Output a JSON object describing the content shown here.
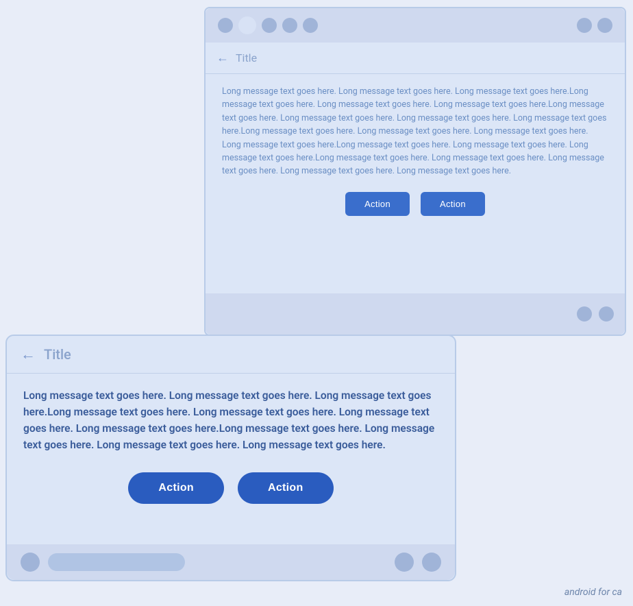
{
  "top_frame": {
    "status_dots": [
      "dot1",
      "dot2",
      "dot3",
      "dot4",
      "dot5"
    ],
    "status_right_dots": [
      "dot-r1",
      "dot-r2"
    ],
    "nav": {
      "back_label": "←",
      "title": "Title"
    },
    "message": "Long message text goes here. Long message text goes here. Long message text goes here.Long message text goes here. Long message text goes here. Long message text goes here.Long message text goes here. Long message text goes here. Long message text goes here. Long message text goes here.Long message text goes here. Long message text goes here. Long message text goes here. Long message text goes here.Long message text goes here. Long message text goes here. Long message text goes here.Long message text goes here. Long message text goes here. Long message text goes here. Long message text goes here. Long message text goes here.",
    "button1": "Action",
    "button2": "Action",
    "bottom_dots": [
      "b1",
      "b2"
    ]
  },
  "bottom_frame": {
    "nav": {
      "back_label": "←",
      "title": "Title"
    },
    "message": "Long message text goes here. Long message text goes here. Long message text goes here.Long message text goes here. Long message text goes here. Long message text goes here. Long message text goes here.Long message text goes here. Long message text goes here. Long message text goes here. Long message text goes here.",
    "button1": "Action",
    "button2": "Action"
  },
  "watermark": "android for ca"
}
